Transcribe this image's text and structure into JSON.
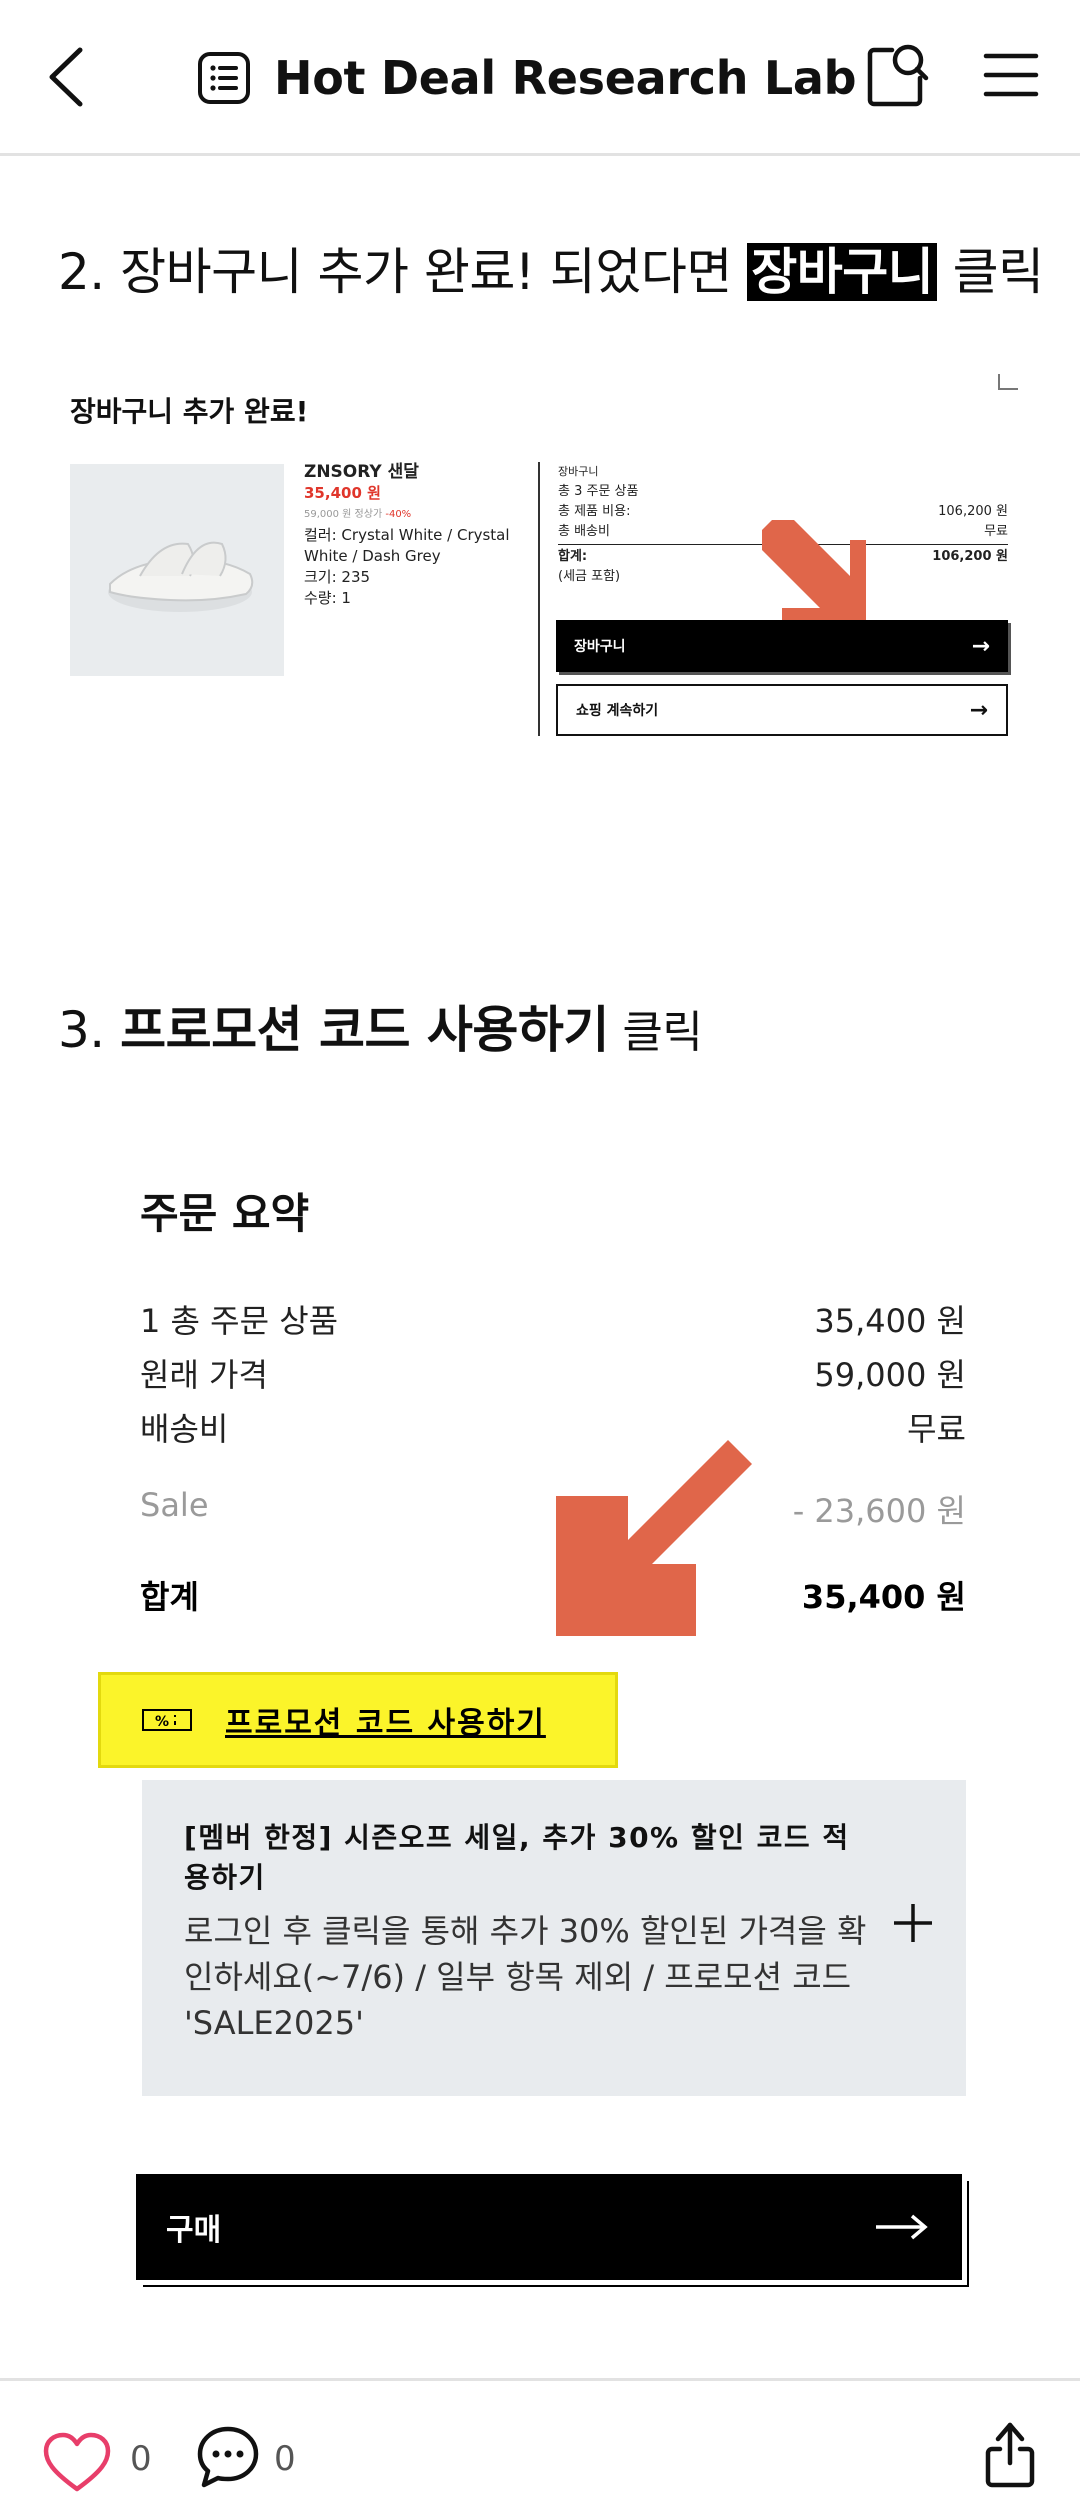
{
  "header": {
    "title": "Hot Deal Research Lab"
  },
  "step2": {
    "prefix": "2. 장바구니 추가 완료! 되었다면 ",
    "highlight": "장바구니",
    "suffix": " 클릭"
  },
  "cart_popup": {
    "title": "장바구니 추가 완료!",
    "product_name": "ZNSORY 샌달",
    "price": "35,400 원",
    "original_price": "59,000 원 정상가",
    "discount": "-40%",
    "color": "컬러: Crystal White / Crystal White / Dash Grey",
    "size": "크기: 235",
    "qty": "수량: 1",
    "summary_heading": "장바구니",
    "summary_count": "총 3 주문 상품",
    "product_cost_label": "총 제품 비용:",
    "product_cost_value": "106,200 원",
    "shipping_label": "총 배송비",
    "shipping_value": "무료",
    "total_label": "합계:",
    "total_value": "106,200 원",
    "tax_note": "(세금 포함)",
    "cart_button": "장바구니",
    "continue_button": "쇼핑 계속하기",
    "arrow_glyph": "→"
  },
  "step3": {
    "prefix": "3. ",
    "bold": "프로모션 코드 사용하기",
    "suffix": " 클릭"
  },
  "order_summary": {
    "title": "주문 요약",
    "rows": [
      {
        "label": "1 총 주문 상품",
        "value": "35,400 원"
      },
      {
        "label": "원래 가격",
        "value": "59,000 원"
      },
      {
        "label": "배송비",
        "value": "무료"
      },
      {
        "label": "Sale",
        "value": "- 23,600 원"
      },
      {
        "label": "합계",
        "value": "35,400 원"
      }
    ],
    "promo_icon_text": "%",
    "promo_label": "프로모션 코드 사용하기",
    "promo_box_title": "[멤버 한정] 시즌오프 세일, 추가 30% 할인 코드 적용하기",
    "promo_box_desc": "로그인 후 클릭을 통해 추가 30% 할인된 가격을 확인하세요(~7/6) / 일부 항목 제외 / 프로모션 코드 'SALE2025'",
    "buy_button": "구매"
  },
  "bottom_bar": {
    "like_count": "0",
    "comment_count": "0"
  },
  "colors": {
    "arrow": "#e0664a",
    "promo_highlight": "#fbf42a",
    "promo_box_bg": "#e8ebee",
    "sale_red": "#e0362b"
  },
  "icons": [
    "back-arrow-icon",
    "list-document-icon",
    "search-bag-icon",
    "hamburger-menu-icon",
    "heart-icon",
    "comment-bubble-icon",
    "share-icon",
    "plus-icon",
    "arrow-right-icon",
    "percent-tag-icon",
    "sandal-product-image"
  ]
}
